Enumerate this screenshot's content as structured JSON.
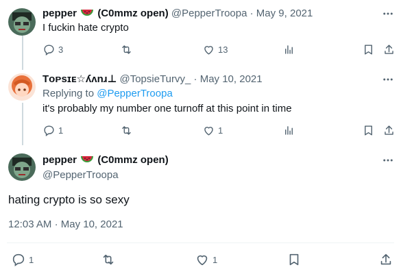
{
  "tweets": [
    {
      "name": "pepper",
      "name_suffix": "(C0mmz open)",
      "handle": "@PepperTroopa",
      "date": "May 9, 2021",
      "text": "I fuckin hate crypto",
      "reply_count": "3",
      "like_count": "13",
      "emoji_icon": "watermelon-icon"
    },
    {
      "name": "Tᴏᴘsɪᴇ☆ʎʌnɹ⊥",
      "handle": "@TopsieTurvy_",
      "date": "May 10, 2021",
      "replying_prefix": "Replying to",
      "replying_to": "@PepperTroopa",
      "text": "it's probably my number one turnoff at this point in time",
      "reply_count": "1",
      "like_count": "1"
    }
  ],
  "main_tweet": {
    "name": "pepper",
    "name_suffix": "(C0mmz open)",
    "handle": "@PepperTroopa",
    "text": "hating crypto is so sexy",
    "time": "12:03 AM",
    "date": "May 10, 2021",
    "reply_count": "1",
    "like_count": "1",
    "emoji_icon": "watermelon-icon"
  },
  "colors": {
    "link": "#1d9bf0",
    "secondary_text": "#536471",
    "thread_line": "#cfd9de"
  }
}
